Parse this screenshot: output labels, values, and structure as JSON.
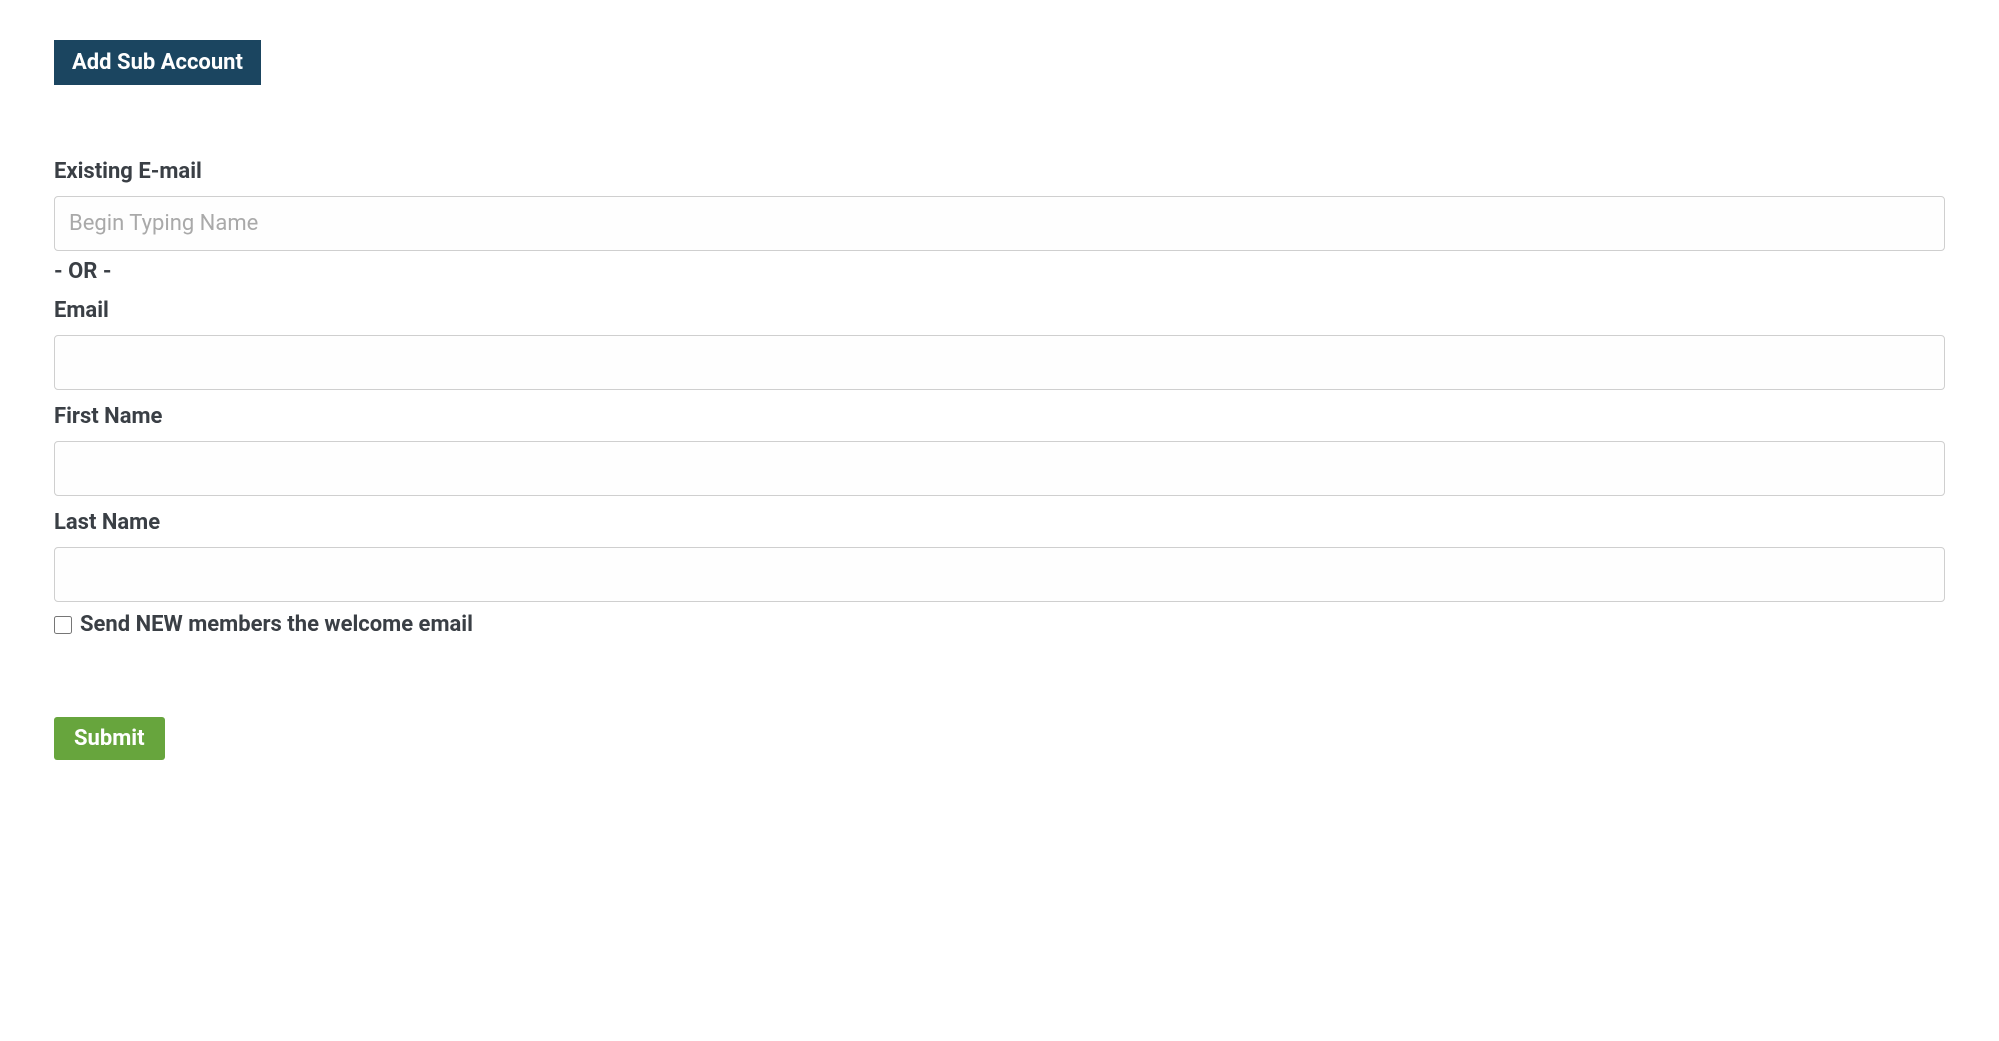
{
  "title": "Add Sub Account",
  "form": {
    "existing_email_label": "Existing E-mail",
    "existing_email_placeholder": "Begin Typing Name",
    "existing_email_value": "",
    "divider_text": "- OR -",
    "email_label": "Email",
    "email_value": "",
    "first_name_label": "First Name",
    "first_name_value": "",
    "last_name_label": "Last Name",
    "last_name_value": "",
    "welcome_checkbox_label": "Send NEW members the welcome email",
    "welcome_checkbox_checked": false,
    "submit_label": "Submit"
  },
  "colors": {
    "title_bg": "#1b4560",
    "submit_bg": "#67a53d",
    "text": "#3a3f45"
  }
}
